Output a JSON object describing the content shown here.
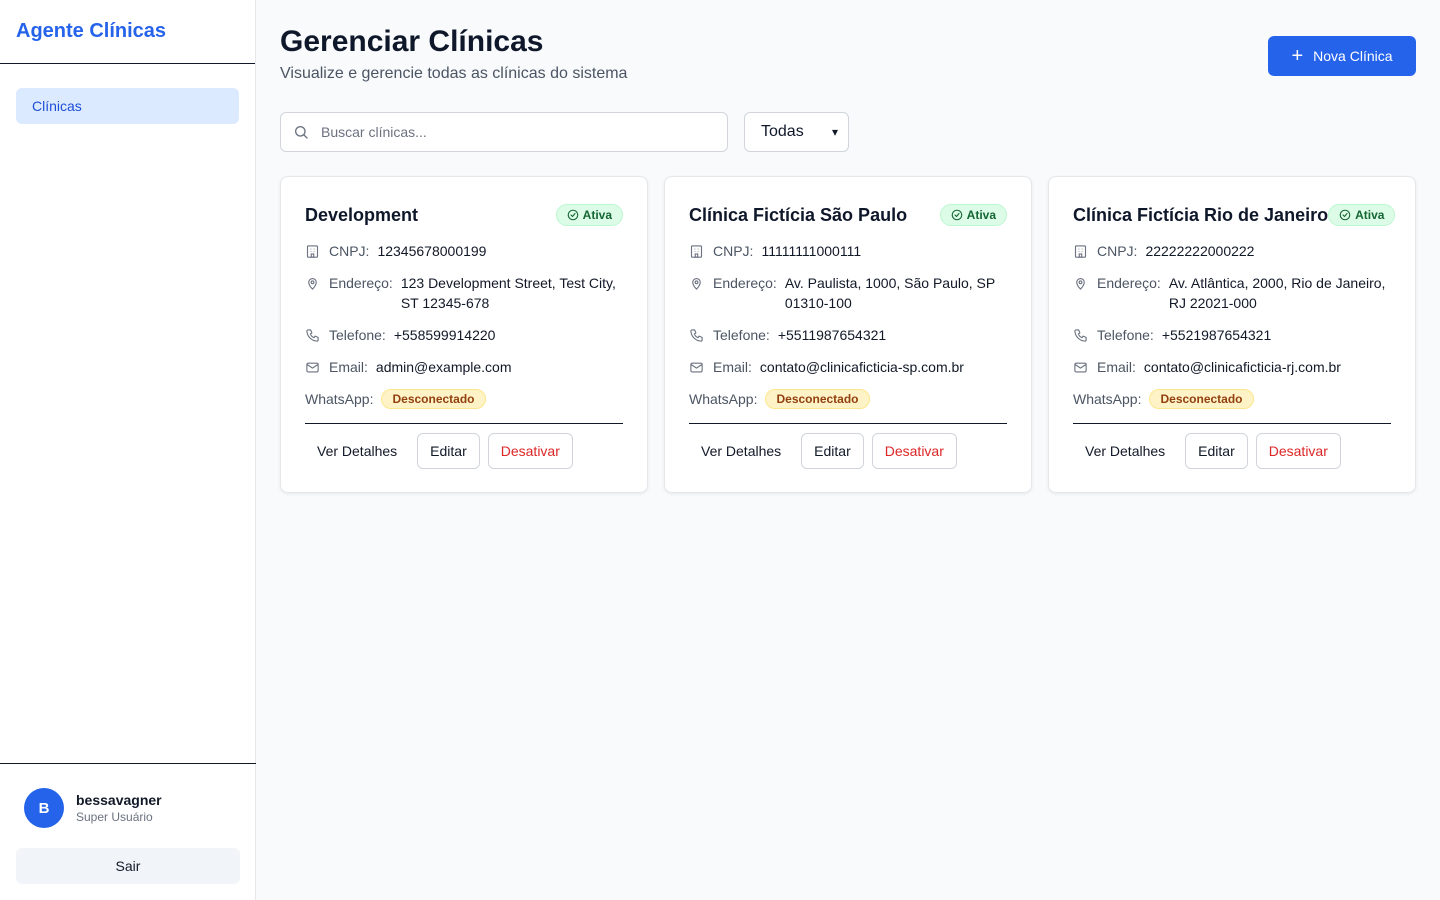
{
  "sidebar": {
    "brand": "Agente Clínicas",
    "nav": [
      {
        "label": "Clínicas"
      }
    ],
    "user": {
      "initial": "B",
      "name": "bessavagner",
      "role": "Super Usuário"
    },
    "logout_label": "Sair"
  },
  "header": {
    "title": "Gerenciar Clínicas",
    "subtitle": "Visualize e gerencie todas as clínicas do sistema",
    "new_button_label": "Nova Clínica"
  },
  "filters": {
    "search_placeholder": "Buscar clínicas...",
    "status_selected": "Todas"
  },
  "labels": {
    "cnpj": "CNPJ:",
    "address": "Endereço:",
    "phone": "Telefone:",
    "email": "Email:",
    "whatsapp": "WhatsApp:",
    "details": "Ver Detalhes",
    "edit": "Editar",
    "deactivate": "Desativar"
  },
  "clinics": [
    {
      "name": "Development",
      "status": "Ativa",
      "cnpj": "12345678000199",
      "address": "123 Development Street, Test City, ST 12345-678",
      "phone": "+558599914220",
      "email": "admin@example.com",
      "whatsapp_status": "Desconectado"
    },
    {
      "name": "Clínica Fictícia São Paulo",
      "status": "Ativa",
      "cnpj": "11111111000111",
      "address": "Av. Paulista, 1000, São Paulo, SP 01310-100",
      "phone": "+5511987654321",
      "email": "contato@clinicaficticia-sp.com.br",
      "whatsapp_status": "Desconectado"
    },
    {
      "name": "Clínica Fictícia Rio de Janeiro",
      "status": "Ativa",
      "cnpj": "22222222000222",
      "address": "Av. Atlântica, 2000, Rio de Janeiro, RJ 22021-000",
      "phone": "+5521987654321",
      "email": "contato@clinicaficticia-rj.com.br",
      "whatsapp_status": "Desconectado"
    }
  ],
  "colors": {
    "primary": "#2563eb",
    "active_badge_bg": "#dcfce7",
    "warn_badge_bg": "#fef3c7",
    "danger": "#dc2626"
  }
}
